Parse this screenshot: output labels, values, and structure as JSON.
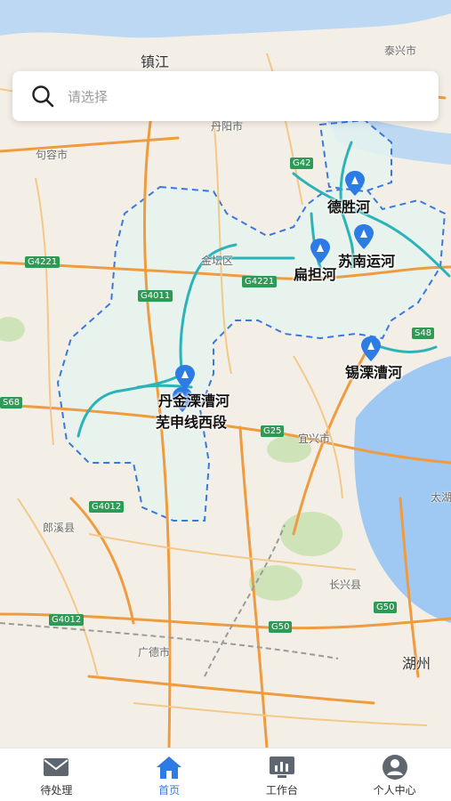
{
  "search": {
    "placeholder": "请选择"
  },
  "map": {
    "places": [
      "镇江",
      "泰兴市",
      "句容市",
      "丹阳市",
      "金坛区",
      "宜兴市",
      "郎溪县",
      "长兴县",
      "广德市",
      "湖州",
      "太湖"
    ],
    "highways": [
      "G4221",
      "G4011",
      "G4221",
      "G42",
      "S48",
      "S68",
      "G25",
      "G4012",
      "G4012",
      "G50",
      "G50"
    ],
    "rivers": [
      {
        "name": "德胜河"
      },
      {
        "name": "苏南运河"
      },
      {
        "name": "扁担河"
      },
      {
        "name": "锡溧漕河"
      },
      {
        "name": "丹金溧漕河"
      },
      {
        "name": "芜申线西段"
      }
    ]
  },
  "tabs": [
    {
      "label": "待处理",
      "icon": "mail-icon"
    },
    {
      "label": "首页",
      "icon": "home-icon"
    },
    {
      "label": "工作台",
      "icon": "workbench-icon"
    },
    {
      "label": "个人中心",
      "icon": "user-icon"
    }
  ],
  "colors": {
    "accent": "#2d7be5",
    "river": "#2bb3b8",
    "region": "#3b78d8"
  }
}
